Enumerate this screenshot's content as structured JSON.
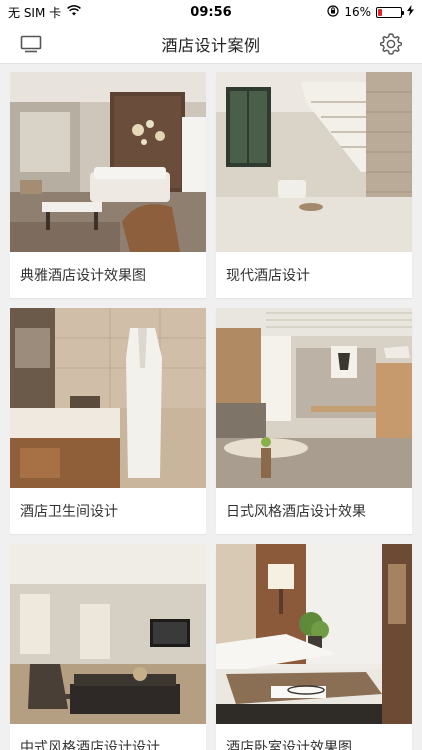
{
  "status_bar": {
    "carrier": "无 SIM 卡",
    "time": "09:56",
    "battery": "16%",
    "battery_level": 0.16,
    "battery_color": "#e0242b"
  },
  "header": {
    "title": "酒店设计案例",
    "left_icon": "screen-icon",
    "right_icon": "gear-icon"
  },
  "cases": [
    {
      "title": "典雅酒店设计效果图"
    },
    {
      "title": "现代酒店设计"
    },
    {
      "title": "酒店卫生间设计"
    },
    {
      "title": "日式风格酒店设计效果"
    },
    {
      "title": "中式风格酒店设计设计"
    },
    {
      "title": "酒店卧室设计效果图"
    }
  ]
}
